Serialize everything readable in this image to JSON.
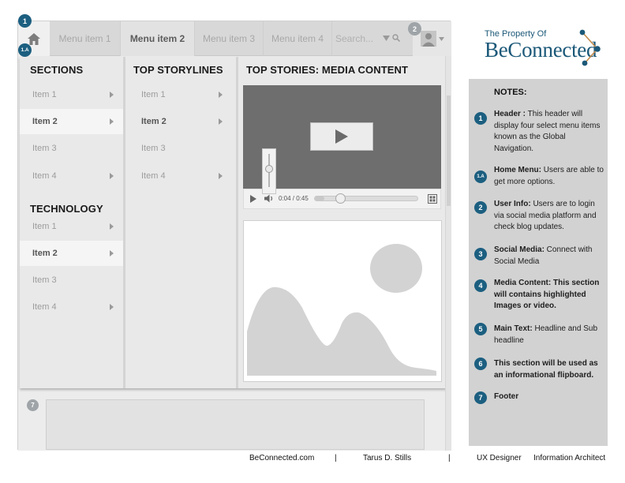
{
  "header": {
    "home_icon": "home-icon",
    "menu": [
      "Menu item 1",
      "Menu item 2",
      "Menu item 3",
      "Menu item 4"
    ],
    "active_menu_index": 1,
    "search_placeholder": "Search...",
    "search_icon": "search-icon",
    "user_icon": "user-icon"
  },
  "dropdown": {
    "sections_title": "SECTIONS",
    "sections_items": [
      "Item 1",
      "Item 2",
      "Item 3",
      "Item 4"
    ],
    "technology_title": "TECHNOLOGY",
    "technology_items": [
      "Item 1",
      "Item 2",
      "Item 3",
      "Item 4"
    ],
    "storylines_title": "TOP STORYLINES",
    "storylines_items": [
      "Item 1",
      "Item 2",
      "Item 3",
      "Item 4"
    ],
    "media_title": "TOP STORIES: MEDIA CONTENT"
  },
  "video": {
    "time": "0:04 / 0:45",
    "progress": 0.09
  },
  "badges": {
    "header": "1",
    "home_menu": "1.A",
    "user": "2",
    "footer": "7"
  },
  "logo": {
    "tagline": "The Property Of",
    "name": "BeConnected"
  },
  "notes": {
    "title": "NOTES:",
    "items": [
      {
        "num": "1",
        "label": "Header :",
        "text": " This header will display four select menu items known as the Global Navigation."
      },
      {
        "num": "1.A",
        "label": "Home Menu:",
        "text": " Users are able to get more options."
      },
      {
        "num": "2",
        "label": "User Info:",
        "text": " Users are to login via social media platform and check blog updates."
      },
      {
        "num": "3",
        "label": "Social Media:",
        "text": " Connect with Social Media"
      },
      {
        "num": "4",
        "label": "Media Content: This section will contains highlighted Images or video.",
        "text": ""
      },
      {
        "num": "5",
        "label": "Main Text:",
        "text": " Headline and Sub headline"
      },
      {
        "num": "6",
        "label": "This section will be used as an informational flipboard.",
        "text": ""
      },
      {
        "num": "7",
        "label": "Footer",
        "text": ""
      }
    ]
  },
  "credits": {
    "site": "BeConnected.com",
    "sep1": "|",
    "author": "Tarus D. Stills",
    "sep2": "|",
    "role1": "UX Designer",
    "role2": "Information Architect"
  },
  "colors": {
    "badge_dark": "#1c5f80",
    "badge_grey": "#9ea4a8",
    "brand": "#1b5878"
  }
}
